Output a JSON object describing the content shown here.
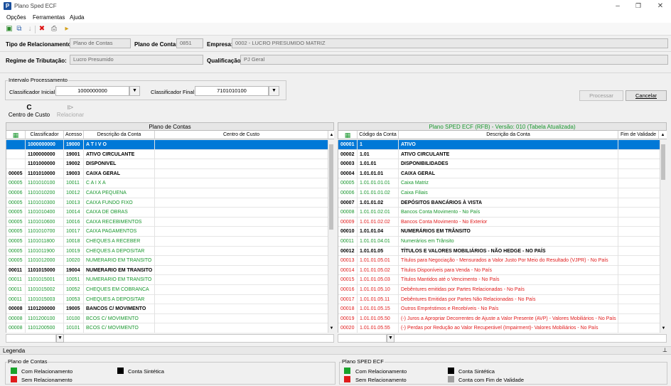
{
  "window": {
    "title": "Plano Sped ECF",
    "app_icon_letter": "P"
  },
  "menu": [
    "Opções",
    "Ferramentas",
    "Ajuda"
  ],
  "toolbar_icons": [
    "new-icon",
    "copy-icon",
    "down-arrow-icon",
    "delete-icon",
    "print-icon",
    "export-icon"
  ],
  "form": {
    "tipo_label": "Tipo de Relacionamento:",
    "tipo_value": "Plano de Contas",
    "plano_label": "Plano de Contas:",
    "plano_value": "0851",
    "empresa_label": "Empresa:",
    "empresa_value": "0002 - LUCRO PRESUMIDO MATRIZ",
    "regime_label": "Regime de Tributação:",
    "regime_value": "Lucro Presumido",
    "qualificacao_label": "Qualificação:",
    "qualificacao_value": "PJ Geral"
  },
  "intervalo": {
    "legend": "Intervalo Processamento",
    "inicial_label": "Classificador Inicial:",
    "inicial_value": "1000000000",
    "final_label": "Classificador Final:",
    "final_value": "7101010100"
  },
  "buttons": {
    "processar": "Processar",
    "cancelar": "Cancelar",
    "centro_custo": "Centro de Custo",
    "centro_custo_letter": "C",
    "relacionar": "Relacionar"
  },
  "left_grid": {
    "title": "Plano de Contas",
    "columns": [
      "Classificador",
      "Acesso",
      "Descrição da Conta",
      "Centro de Custo"
    ],
    "rows": [
      {
        "k": "sel",
        "a": "",
        "b": "1000000000",
        "c": "19000",
        "d": "A T I V O"
      },
      {
        "k": "syn",
        "a": "",
        "b": "1100000000",
        "c": "19001",
        "d": "ATIVO CIRCULANTE"
      },
      {
        "k": "syn",
        "a": "",
        "b": "1101000000",
        "c": "19002",
        "d": "DISPONIVEL"
      },
      {
        "k": "syn",
        "a": "00005",
        "b": "1101010000",
        "c": "19003",
        "d": "CAIXA GERAL"
      },
      {
        "k": "grn",
        "a": "00005",
        "b": "1101010100",
        "c": "10011",
        "d": "C A I X A"
      },
      {
        "k": "grn",
        "a": "00006",
        "b": "1101010200",
        "c": "10012",
        "d": "CAIXA PEQUENA"
      },
      {
        "k": "grn",
        "a": "00005",
        "b": "1101010300",
        "c": "10013",
        "d": "CAIXA FUNDO FIXO"
      },
      {
        "k": "grn",
        "a": "00005",
        "b": "1101010400",
        "c": "10014",
        "d": "CAIXA DE OBRAS"
      },
      {
        "k": "grn",
        "a": "00005",
        "b": "1101010600",
        "c": "10016",
        "d": "CAIXA RECEBIMENTOS"
      },
      {
        "k": "grn",
        "a": "00005",
        "b": "1101010700",
        "c": "10017",
        "d": "CAIXA PAGAMENTOS"
      },
      {
        "k": "grn",
        "a": "00005",
        "b": "1101011800",
        "c": "10018",
        "d": "CHEQUES A RECEBER"
      },
      {
        "k": "grn",
        "a": "00005",
        "b": "1101011900",
        "c": "10019",
        "d": "CHEQUES A DEPOSITAR"
      },
      {
        "k": "grn",
        "a": "00005",
        "b": "1101012000",
        "c": "10020",
        "d": "NUMERARIO EM TRANSITO"
      },
      {
        "k": "syn",
        "a": "00011",
        "b": "1101015000",
        "c": "19004",
        "d": "NUMERARIO EM TRANSITO"
      },
      {
        "k": "grn",
        "a": "00011",
        "b": "1101015001",
        "c": "10051",
        "d": "NUMERARIO EM TRANSITO"
      },
      {
        "k": "grn",
        "a": "00011",
        "b": "1101015002",
        "c": "10052",
        "d": "CHEQUES EM COBRANCA"
      },
      {
        "k": "grn",
        "a": "00011",
        "b": "1101015003",
        "c": "10053",
        "d": "CHEQUES A DEPOSITAR"
      },
      {
        "k": "syn",
        "a": "00008",
        "b": "1101200000",
        "c": "19005",
        "d": "BANCOS C/ MOVIMENTO"
      },
      {
        "k": "grn",
        "a": "00008",
        "b": "1101200100",
        "c": "10100",
        "d": "BCOS C/ MOVIMENTO"
      },
      {
        "k": "grn",
        "a": "00008",
        "b": "1101200500",
        "c": "10101",
        "d": "BCOS C/ MOVIMENTO"
      }
    ]
  },
  "right_grid": {
    "title": "Plano SPED ECF (RFB) - Versão: 010 (Tabela Atualizada)",
    "title_color": "#18962d",
    "columns": [
      "Código da Conta",
      "Descrição da Conta",
      "Fim de Validade"
    ],
    "rows": [
      {
        "k": "sel",
        "a": "00001",
        "b": "1",
        "c": "ATIVO"
      },
      {
        "k": "syn",
        "a": "00002",
        "b": "1.01",
        "c": "ATIVO CIRCULANTE"
      },
      {
        "k": "syn",
        "a": "00003",
        "b": "1.01.01",
        "c": "DISPONIBILIDADES"
      },
      {
        "k": "syn",
        "a": "00004",
        "b": "1.01.01.01",
        "c": "CAIXA GERAL"
      },
      {
        "k": "grn",
        "a": "00005",
        "b": "1.01.01.01.01",
        "c": "Caixa Matriz"
      },
      {
        "k": "grn",
        "a": "00006",
        "b": "1.01.01.01.02",
        "c": "Caixa Filiais"
      },
      {
        "k": "syn",
        "a": "00007",
        "b": "1.01.01.02",
        "c": "DEPÓSITOS BANCÁRIOS À VISTA"
      },
      {
        "k": "grn",
        "a": "00008",
        "b": "1.01.01.02.01",
        "c": "Bancos Conta Movimento - No País"
      },
      {
        "k": "red",
        "a": "00009",
        "b": "1.01.01.02.02",
        "c": "Bancos Conta Movimento - No Exterior"
      },
      {
        "k": "syn",
        "a": "00010",
        "b": "1.01.01.04",
        "c": "NUMERÁRIOS EM TRÂNSITO"
      },
      {
        "k": "grn",
        "a": "00011",
        "b": "1.01.01.04.01",
        "c": "Numerários em Trânsito"
      },
      {
        "k": "syn",
        "a": "00012",
        "b": "1.01.01.05",
        "c": "TÍTULOS E VALORES MOBILIÁRIOS - NÃO HEDGE - NO PAÍS"
      },
      {
        "k": "red",
        "a": "00013",
        "b": "1.01.01.05.01",
        "c": "Títulos para Negociação - Mensurados a Valor Justo Por Meio do Resultado (VJPR) - No País"
      },
      {
        "k": "red",
        "a": "00014",
        "b": "1.01.01.05.02",
        "c": "Títulos Disponíveis para Venda - No País"
      },
      {
        "k": "red",
        "a": "00015",
        "b": "1.01.01.05.03",
        "c": "Títulos Mantidos até o Vencimento - No País"
      },
      {
        "k": "red",
        "a": "00016",
        "b": "1.01.01.05.10",
        "c": "Debêntures emitidas por Partes Relacionadas - No País"
      },
      {
        "k": "red",
        "a": "00017",
        "b": "1.01.01.05.11",
        "c": "Debêntures Emitidas por Partes Não Relacionadas - No País"
      },
      {
        "k": "red",
        "a": "00018",
        "b": "1.01.01.05.15",
        "c": "Outros Empréstimos e Recebíveis - No País"
      },
      {
        "k": "red",
        "a": "00019",
        "b": "1.01.01.05.50",
        "c": "(-) Juros a Apropriar Decorrentes de Ajuste a Valor Presente (AVP) -  Valores Mobiliários - No País"
      },
      {
        "k": "red",
        "a": "00020",
        "b": "1.01.01.05.55",
        "c": "(-) Perdas por Redução ao Valor Recuperável (Impairment)- Valores Mobiliários - No País"
      }
    ]
  },
  "legend": {
    "title": "Legenda",
    "left_title": "Plano de Contas",
    "left_items": [
      {
        "label": "Com Relacionamento",
        "color": "#18a32b"
      },
      {
        "label": "Sem Relacionamento",
        "color": "#e01b1b"
      },
      {
        "label": "Conta Sintética",
        "color": "#000000"
      }
    ],
    "right_title": "Plano SPED ECF",
    "right_items": [
      {
        "label": "Com Relacionamento",
        "color": "#18a32b"
      },
      {
        "label": "Sem Relacionamento",
        "color": "#e01b1b"
      },
      {
        "label": "Conta Sintética",
        "color": "#000000"
      },
      {
        "label": "Conta com Fim de Validade",
        "color": "#a0a0a0"
      }
    ]
  }
}
